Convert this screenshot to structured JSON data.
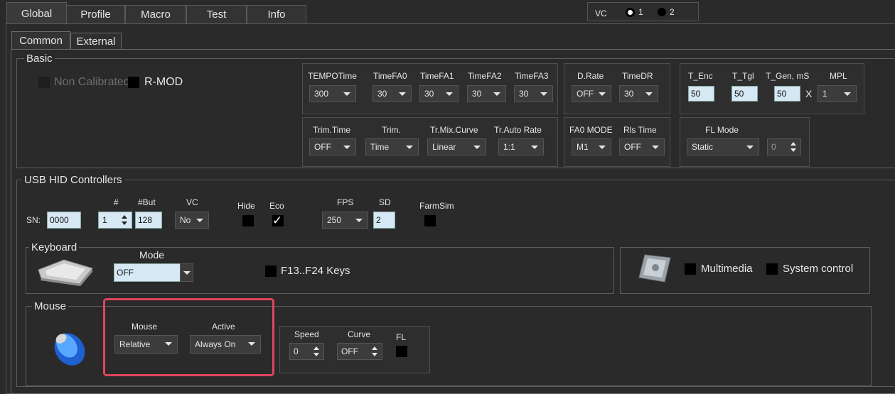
{
  "main_tabs": [
    "Global",
    "Profile",
    "Macro",
    "Test",
    "Info"
  ],
  "vc_selector": {
    "label": "VC",
    "option1": "1",
    "option2": "2",
    "selected": 1
  },
  "sub_tabs": [
    "Common",
    "External"
  ],
  "basic": {
    "title": "Basic",
    "non_calibrated": "Non Calibrated",
    "rmod": "R-MOD",
    "tempo": {
      "labels": [
        "TEMPOTime",
        "TimeFA0",
        "TimeFA1",
        "TimeFA2",
        "TimeFA3"
      ],
      "values": [
        "300",
        "30",
        "30",
        "30",
        "30"
      ]
    },
    "drate": {
      "labels": [
        "D.Rate",
        "TimeDR"
      ],
      "values": [
        "OFF",
        "30"
      ]
    },
    "enc": {
      "labels": [
        "T_Enc",
        "T_Tgl",
        "T_Gen, mS",
        "MPL"
      ],
      "values": [
        "50",
        "50",
        "50",
        "1"
      ],
      "x": "X"
    },
    "trim": {
      "labels": [
        "Trim.Time",
        "Trim.",
        "Tr.Mix.Curve",
        "Tr.Auto Rate"
      ],
      "values": [
        "OFF",
        "Time",
        "Linear",
        "1:1"
      ]
    },
    "fa0": {
      "labels": [
        "FA0 MODE",
        "Rls Time"
      ],
      "values": [
        "M1",
        "OFF"
      ]
    },
    "flmode": {
      "label": "FL Mode",
      "value": "Static",
      "spin": "0"
    }
  },
  "usb": {
    "title": "USB HID Controllers",
    "sn_label": "SN:",
    "sn_value": "0000",
    "labels": {
      "num": "#",
      "but": "#But",
      "vc": "VC",
      "hide": "Hide",
      "eco": "Eco",
      "fps": "FPS",
      "sd": "SD",
      "farmsim": "FarmSim"
    },
    "values": {
      "num": "1",
      "but": "128",
      "vc": "No",
      "fps": "250",
      "sd": "2"
    }
  },
  "keyboard": {
    "title": "Keyboard",
    "mode_label": "Mode",
    "mode_value": "OFF",
    "f13": "F13..F24 Keys"
  },
  "media": {
    "multimedia": "Multimedia",
    "system": "System control"
  },
  "mouse": {
    "title": "Mouse",
    "mouse_label": "Mouse",
    "mouse_value": "Relative",
    "active_label": "Active",
    "active_value": "Always On",
    "speed_label": "Speed",
    "speed_value": "0",
    "curve_label": "Curve",
    "curve_value": "OFF",
    "fl_label": "FL"
  },
  "colors": {
    "highlight": "#e0455e",
    "input_bg": "#d6e8f4"
  }
}
